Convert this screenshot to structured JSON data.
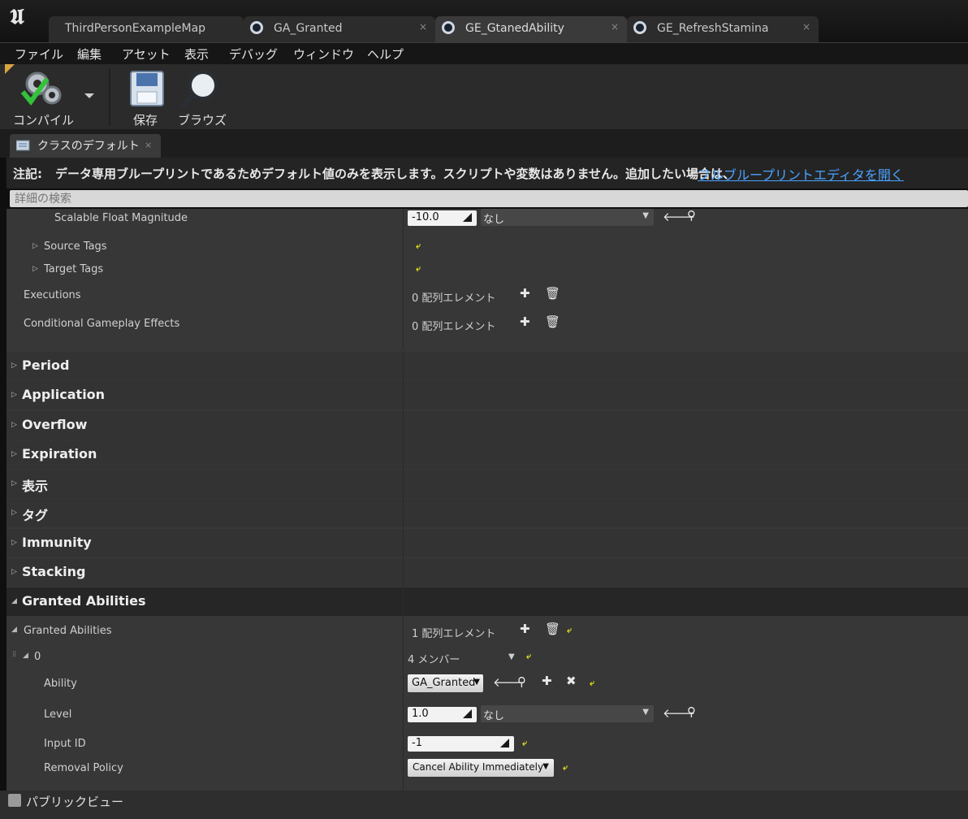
{
  "window": {
    "tabs": [
      {
        "label": "ThirdPersonExampleMap"
      },
      {
        "label": "GA_Granted",
        "close": "×"
      },
      {
        "label": "GE_GtanedAbility",
        "close": "×"
      },
      {
        "label": "GE_RefreshStamina",
        "close": "×"
      }
    ]
  },
  "menu": [
    "ファイル",
    "編集",
    "アセット",
    "表示",
    "デバッグ",
    "ウィンドウ",
    "ヘルプ"
  ],
  "toolbar": {
    "compile_label": "コンパイル",
    "save_label": "保存",
    "browse_label": "ブラウズ"
  },
  "details_tab": {
    "label": "クラスのデフォルト",
    "close": "×"
  },
  "notice": {
    "prefix": "注記:",
    "text": "データ専用ブループリントであるためデフォルト値のみを表示します。スクリプトや変数はありません。追加したい場合は、",
    "link": "フルブループリントエディタを開く"
  },
  "search": {
    "placeholder": "詳細の検索"
  },
  "properties": {
    "scalable_float": {
      "name": "Scalable Float Magnitude",
      "value": "-10.0",
      "curve": "なし"
    },
    "source_tags": {
      "name": "Source Tags"
    },
    "target_tags": {
      "name": "Target Tags"
    },
    "executions": {
      "name": "Executions",
      "value": "0 配列エレメント"
    },
    "conditional": {
      "name": "Conditional Gameplay Effects",
      "value": "0 配列エレメント"
    }
  },
  "categories": [
    "Period",
    "Application",
    "Overflow",
    "Expiration",
    "表示",
    "タグ",
    "Immunity",
    "Stacking"
  ],
  "granted": {
    "header": "Granted Abilities",
    "array_name": "Granted Abilities",
    "array_value": "1 配列エレメント",
    "index": "0",
    "members": "4 メンバー",
    "ability": {
      "name": "Ability",
      "value": "GA_Granted"
    },
    "level": {
      "name": "Level",
      "value": "1.0",
      "curve": "なし"
    },
    "input_id": {
      "name": "Input ID",
      "value": "-1"
    },
    "removal": {
      "name": "Removal Policy",
      "value": "Cancel Ability Immediately"
    }
  },
  "footer": {
    "public_view": "パブリックビュー"
  },
  "colors": {
    "link": "#4aa3ff",
    "reset_arrow": "#e3e01c",
    "panel": "#373737"
  }
}
